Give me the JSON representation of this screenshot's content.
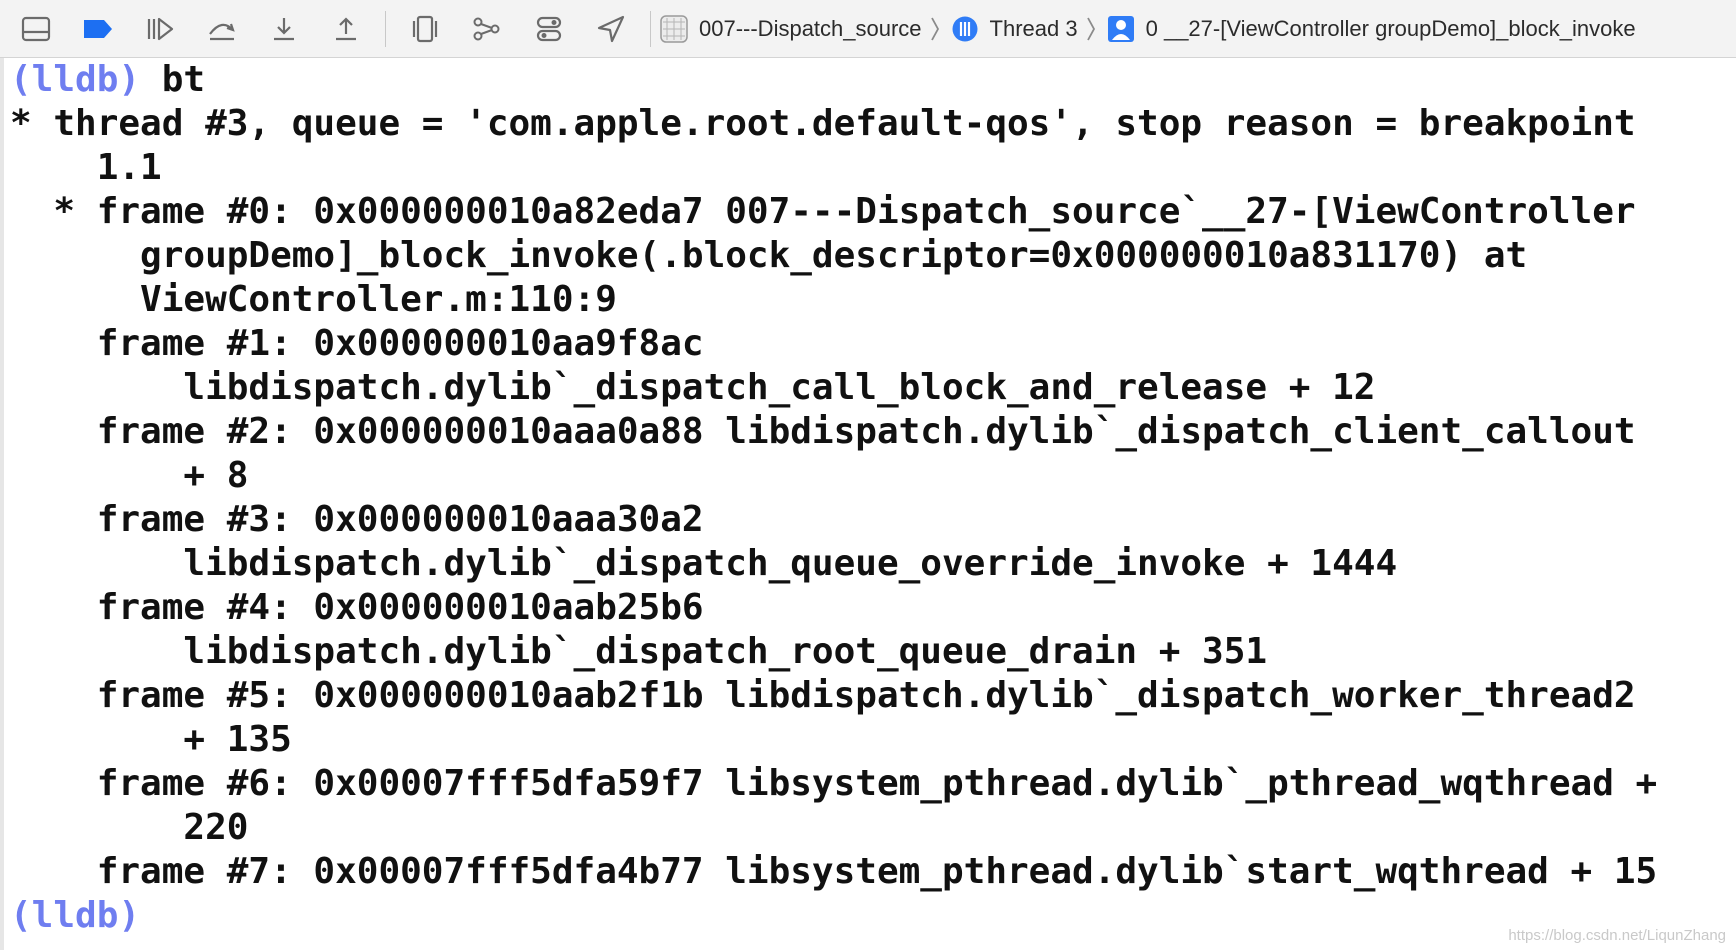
{
  "toolbar": {
    "buttons": [
      {
        "icon": "hide-debug-area-icon"
      },
      {
        "icon": "breakpoints-toggle-icon",
        "color": "#1d6ff2"
      },
      {
        "icon": "continue-icon"
      },
      {
        "icon": "step-over-icon"
      },
      {
        "icon": "step-into-icon"
      },
      {
        "icon": "step-out-icon"
      },
      {
        "icon": "debug-view-hierarchy-icon"
      },
      {
        "icon": "memory-graph-icon"
      },
      {
        "icon": "environment-overrides-icon"
      },
      {
        "icon": "simulate-location-icon"
      }
    ],
    "breadcrumb": {
      "target": "007---Dispatch_source",
      "thread": "Thread 3",
      "frame": "0 __27-[ViewController groupDemo]_block_invoke"
    }
  },
  "console": {
    "prompt": "(lldb)",
    "command": " bt",
    "lines": [
      "* thread #3, queue = 'com.apple.root.default-qos', stop reason = breakpoint",
      "    1.1",
      "  * frame #0: 0x000000010a82eda7 007---Dispatch_source`__27-[ViewController",
      "      groupDemo]_block_invoke(.block_descriptor=0x000000010a831170) at",
      "      ViewController.m:110:9",
      "    frame #1: 0x000000010aa9f8ac",
      "        libdispatch.dylib`_dispatch_call_block_and_release + 12",
      "    frame #2: 0x000000010aaa0a88 libdispatch.dylib`_dispatch_client_callout",
      "        + 8",
      "    frame #3: 0x000000010aaa30a2",
      "        libdispatch.dylib`_dispatch_queue_override_invoke + 1444",
      "    frame #4: 0x000000010aab25b6",
      "        libdispatch.dylib`_dispatch_root_queue_drain + 351",
      "    frame #5: 0x000000010aab2f1b libdispatch.dylib`_dispatch_worker_thread2",
      "        + 135",
      "    frame #6: 0x00007fff5dfa59f7 libsystem_pthread.dylib`_pthread_wqthread +",
      "        220",
      "    frame #7: 0x00007fff5dfa4b77 libsystem_pthread.dylib`start_wqthread + 15"
    ],
    "final_prompt": "(lldb)"
  },
  "watermark": "https://blog.csdn.net/LiqunZhang",
  "colors": {
    "prompt": "#6f7ef0",
    "accent": "#1d6ff2",
    "toolbar_bg": "#f3f3f3"
  }
}
